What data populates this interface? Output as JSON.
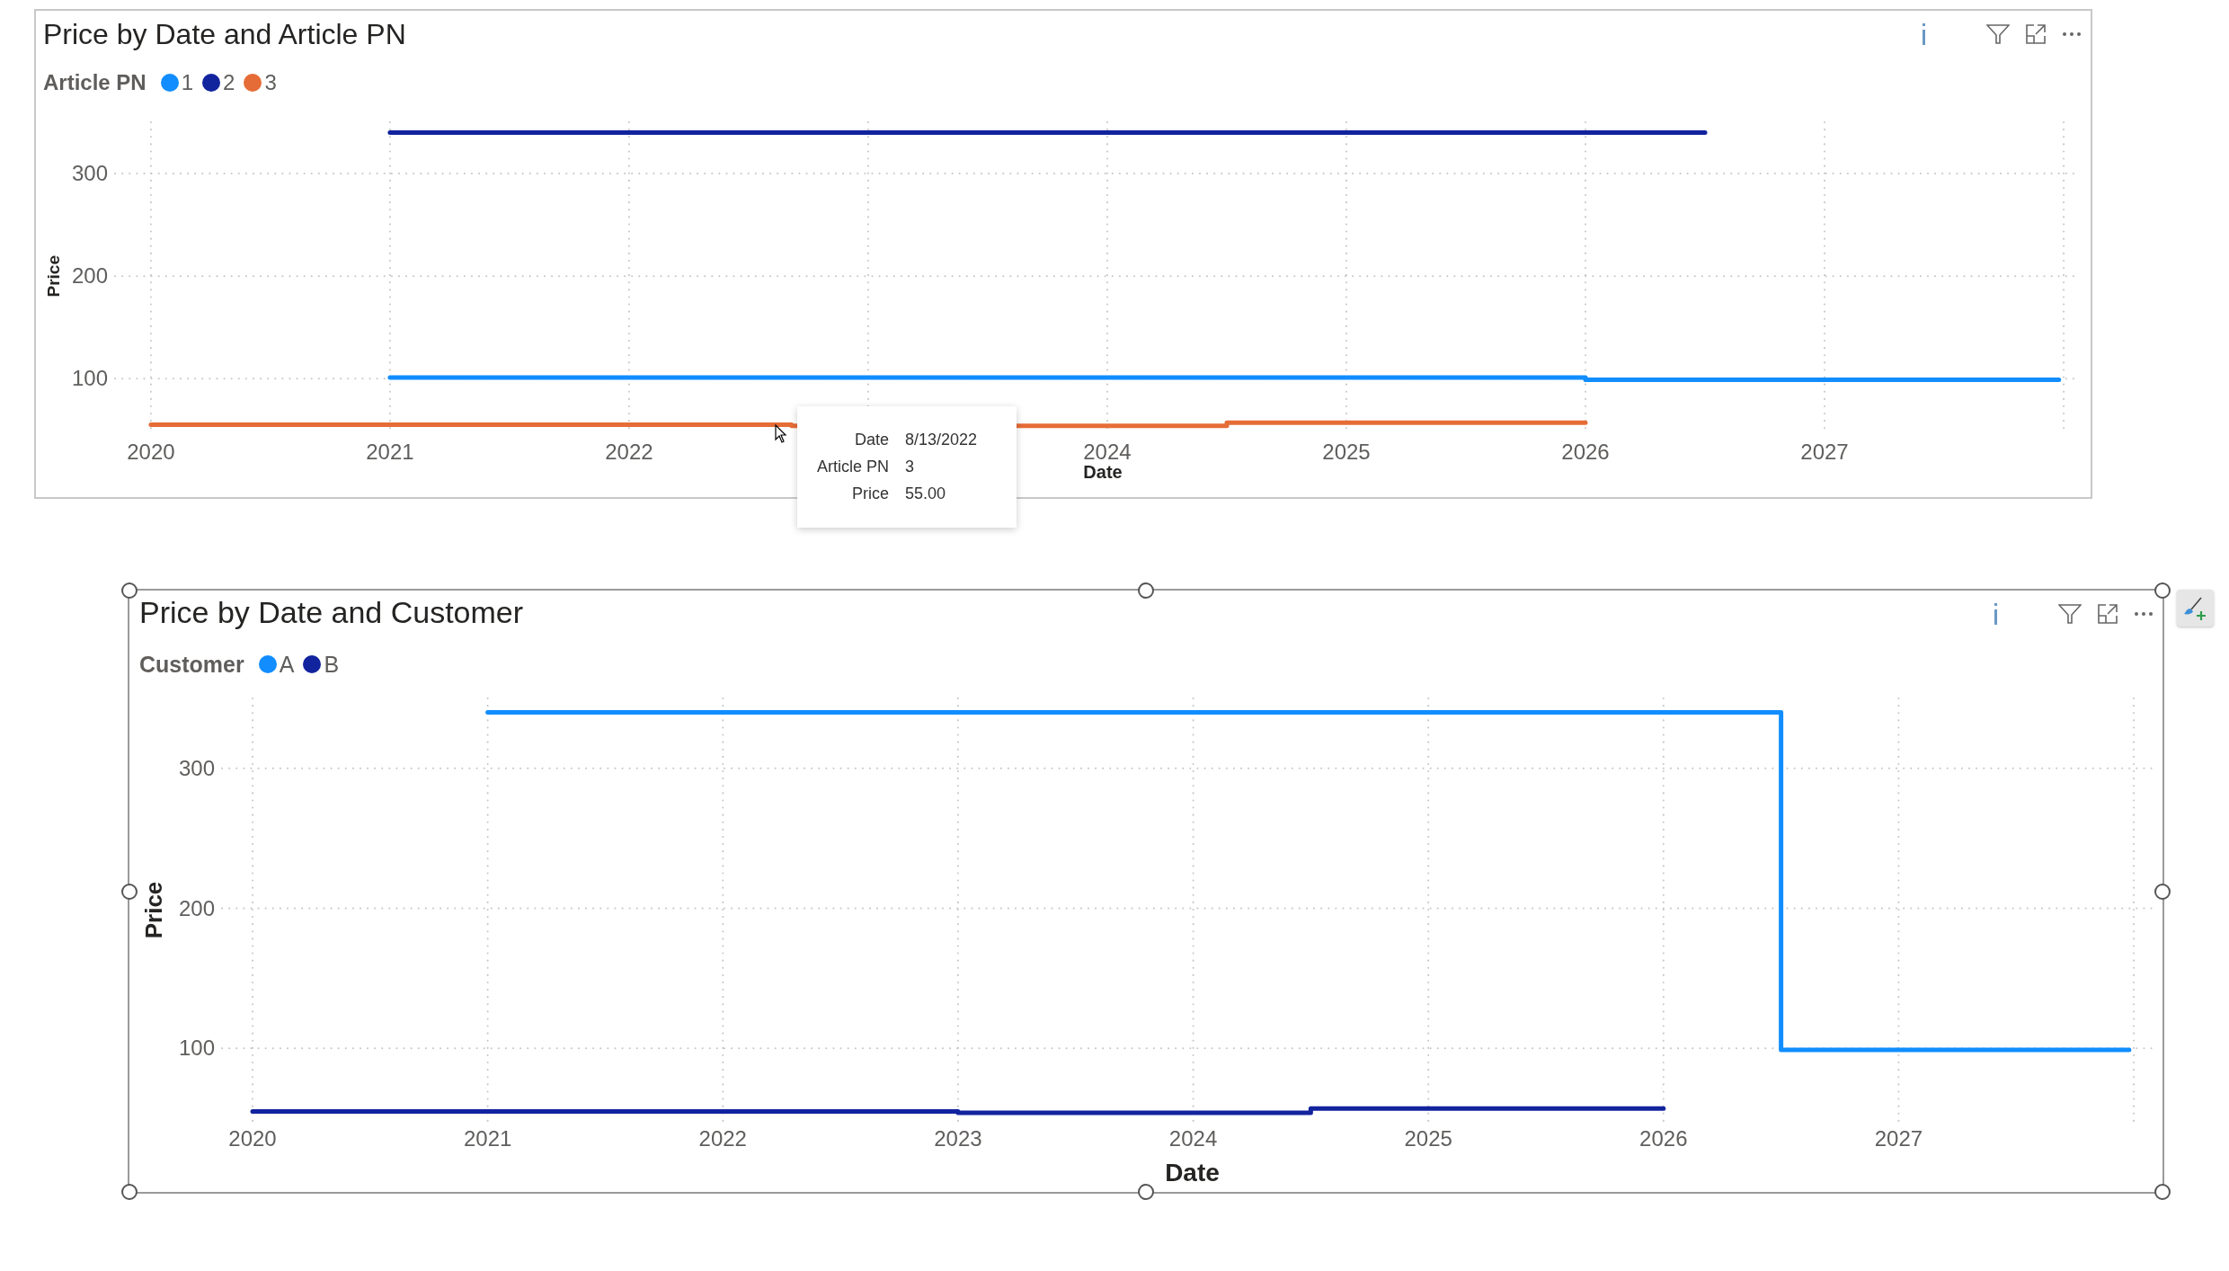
{
  "visuals": [
    {
      "title": "Price by Date and Article PN",
      "selected": false,
      "legend_title": "Article PN",
      "chart_data": {
        "type": "line",
        "xlabel": "Date",
        "ylabel": "Price",
        "grid": true,
        "x": [
          2020,
          2021,
          2022.68,
          2022.68,
          2024.5,
          2024.5,
          2026,
          2026,
          2026.5,
          2027.98
        ],
        "series": [
          {
            "name": "1",
            "color": "#118dff",
            "values": [
              null,
              101,
              101,
              101,
              101,
              101,
              101,
              99,
              99,
              99
            ]
          },
          {
            "name": "2",
            "color": "#12239e",
            "values": [
              null,
              340,
              340,
              340,
              340,
              340,
              340,
              340,
              340,
              null
            ]
          },
          {
            "name": "3",
            "color": "#e66c37",
            "values": [
              55,
              55,
              55,
              54,
              54,
              57,
              57,
              null,
              null,
              null
            ]
          }
        ],
        "xlim": [
          2019.85,
          2028.06
        ],
        "ylim": [
          45,
          350
        ],
        "xticks": [
          2020,
          2021,
          2022,
          2024,
          2025,
          2026,
          2027
        ],
        "yticks": [
          100,
          200,
          300
        ]
      },
      "tooltip": {
        "rows": [
          {
            "label": "Date",
            "value": "8/13/2022"
          },
          {
            "label": "Article PN",
            "value": "3"
          },
          {
            "label": "Price",
            "value": "55.00"
          }
        ]
      }
    },
    {
      "title": "Price by Date and Customer",
      "selected": true,
      "legend_title": "Customer",
      "chart_data": {
        "type": "line",
        "xlabel": "Date",
        "ylabel": "Price",
        "grid": true,
        "x": [
          2020,
          2021,
          2023,
          2023,
          2024.5,
          2024.5,
          2026,
          2026.5,
          2026.5,
          2027.98
        ],
        "series": [
          {
            "name": "A",
            "color": "#118dff",
            "values": [
              null,
              340,
              340,
              340,
              340,
              340,
              340,
              340,
              99,
              99
            ]
          },
          {
            "name": "B",
            "color": "#12239e",
            "values": [
              55,
              55,
              55,
              54,
              54,
              57,
              57,
              null,
              null,
              null
            ]
          }
        ],
        "xlim": [
          2019.87,
          2028.08
        ],
        "ylim": [
          45,
          350
        ],
        "xticks": [
          2020,
          2021,
          2022,
          2023,
          2024,
          2025,
          2026,
          2027
        ],
        "yticks": [
          100,
          200,
          300
        ]
      }
    }
  ]
}
